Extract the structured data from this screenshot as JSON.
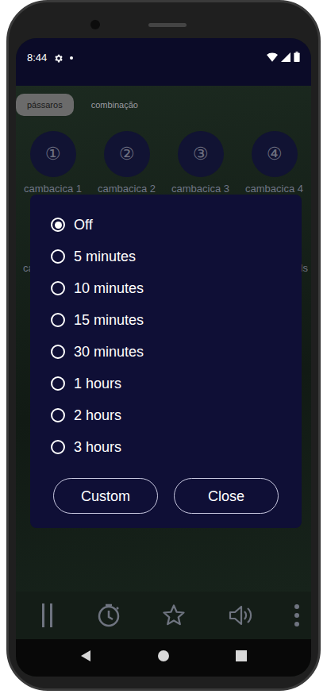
{
  "status_bar": {
    "time": "8:44"
  },
  "tabs": [
    {
      "label": "pássaros",
      "selected": true
    },
    {
      "label": "combinação",
      "selected": false
    }
  ],
  "sounds": [
    {
      "number": "①",
      "label": "cambacica 1"
    },
    {
      "number": "②",
      "label": "cambacica 2"
    },
    {
      "number": "③",
      "label": "cambacica 3"
    },
    {
      "number": "④",
      "label": "cambacica 4"
    }
  ],
  "second_row": {
    "left": "ca",
    "right": "ls"
  },
  "timer_dialog": {
    "options": [
      {
        "label": "Off",
        "selected": true
      },
      {
        "label": "5 minutes",
        "selected": false
      },
      {
        "label": "10 minutes",
        "selected": false
      },
      {
        "label": "15 minutes",
        "selected": false
      },
      {
        "label": "30 minutes",
        "selected": false
      },
      {
        "label": "1 hours",
        "selected": false
      },
      {
        "label": "2 hours",
        "selected": false
      },
      {
        "label": "3 hours",
        "selected": false
      }
    ],
    "buttons": [
      "Custom",
      "Close"
    ]
  }
}
